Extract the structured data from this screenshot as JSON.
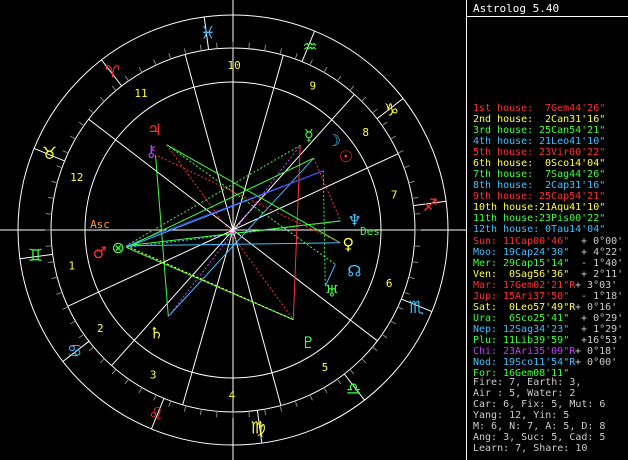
{
  "app": {
    "title": "Astrolog 5.40"
  },
  "colors": {
    "background": "#000000",
    "fire": "#ff2020",
    "earth": "#ffff00",
    "air": "#00ff40",
    "water": "#00c0ff",
    "ruler_orange": "#ff9a30",
    "purple": "#c040ff",
    "white": "#ffffff"
  },
  "wheel": {
    "houses": [
      "1",
      "2",
      "3",
      "4",
      "5",
      "6",
      "7",
      "8",
      "9",
      "10",
      "11",
      "12"
    ],
    "angles": [
      "Asc",
      "Des"
    ],
    "signs": [
      {
        "name": "aries-glyph",
        "glyph": "♈"
      },
      {
        "name": "taurus-glyph",
        "glyph": "♉"
      },
      {
        "name": "gemini-glyph",
        "glyph": "♊"
      },
      {
        "name": "cancer-glyph",
        "glyph": "♋"
      },
      {
        "name": "leo-glyph",
        "glyph": "♌"
      },
      {
        "name": "virgo-glyph",
        "glyph": "♍"
      },
      {
        "name": "libra-glyph",
        "glyph": "♎"
      },
      {
        "name": "scorpio-glyph",
        "glyph": "♏"
      },
      {
        "name": "sagittarius-glyph",
        "glyph": "♐"
      },
      {
        "name": "capricorn-glyph",
        "glyph": "♑"
      },
      {
        "name": "aquarius-glyph",
        "glyph": "♒"
      },
      {
        "name": "pisces-glyph",
        "glyph": "♓"
      }
    ],
    "planet_glyphs": [
      {
        "name": "sun-glyph",
        "glyph": "☉"
      },
      {
        "name": "moon-glyph",
        "glyph": "☽"
      },
      {
        "name": "mercury-glyph",
        "glyph": "☿"
      },
      {
        "name": "venus-glyph",
        "glyph": "♀"
      },
      {
        "name": "mars-glyph",
        "glyph": "♂"
      },
      {
        "name": "jupiter-glyph",
        "glyph": "♃"
      },
      {
        "name": "saturn-glyph",
        "glyph": "♄"
      },
      {
        "name": "uranus-glyph",
        "glyph": "♅"
      },
      {
        "name": "neptune-glyph",
        "glyph": "♆"
      },
      {
        "name": "pluto-glyph",
        "glyph": "♇"
      },
      {
        "name": "chiron-glyph",
        "glyph": "⚷"
      },
      {
        "name": "node-glyph",
        "glyph": "☊"
      },
      {
        "name": "fortune-glyph",
        "glyph": "⊗"
      }
    ]
  },
  "houses_list": [
    {
      "label": "1st house:",
      "pos": " 7Gem44'26\"",
      "color": "#ff3030"
    },
    {
      "label": "2nd house:",
      "pos": " 2Can31'16\"",
      "color": "#ffff40"
    },
    {
      "label": "3rd house:",
      "pos": "25Can54'21\"",
      "color": "#40ff40"
    },
    {
      "label": "4th house:",
      "pos": "21Leo41'10\"",
      "color": "#40c0ff"
    },
    {
      "label": "5th house:",
      "pos": "23Vir00'22\"",
      "color": "#ff3030"
    },
    {
      "label": "6th house:",
      "pos": " 0Sco14'04\"",
      "color": "#ffff40"
    },
    {
      "label": "7th house:",
      "pos": " 7Sag44'26\"",
      "color": "#40ff40"
    },
    {
      "label": "8th house:",
      "pos": " 2Cap31'16\"",
      "color": "#40c0ff"
    },
    {
      "label": "9th house:",
      "pos": "25Cap54'21\"",
      "color": "#ff3030"
    },
    {
      "label": "10th house:",
      "pos": "21Aqu41'10\"",
      "color": "#ffff40"
    },
    {
      "label": "11th house:",
      "pos": "23Pis00'22\"",
      "color": "#40ff40"
    },
    {
      "label": "12th house:",
      "pos": " 0Tau14'04\"",
      "color": "#40c0ff"
    }
  ],
  "planets_list": [
    {
      "label": "Sun:",
      "pos": "11Cap00'46\"",
      "dec": "  + 0°00'",
      "color": "#ff3030"
    },
    {
      "label": "Moo:",
      "pos": "19Cap24'30\"",
      "dec": "  + 4°22'",
      "color": "#40c0ff"
    },
    {
      "label": "Mer:",
      "pos": "29Cap15'14\"",
      "dec": "  - 1°40'",
      "color": "#40ff40"
    },
    {
      "label": "Ven:",
      "pos": " 0Sag56'36\"",
      "dec": "  + 2°11'",
      "color": "#ffff40"
    },
    {
      "label": "Mar:",
      "pos": "17Gem02'21\"R",
      "dec": " + 3°03'",
      "color": "#ff3030"
    },
    {
      "label": "Jup:",
      "pos": "15Ari37'50\"",
      "dec": "  - 1°18'",
      "color": "#ff3030"
    },
    {
      "label": "Sat:",
      "pos": " 0Leo57'49\"R",
      "dec": " + 0°16'",
      "color": "#ffff40"
    },
    {
      "label": "Ura:",
      "pos": " 6Sco25'41\"",
      "dec": "  + 0°29'",
      "color": "#40ff40"
    },
    {
      "label": "Nep:",
      "pos": "12Sag34'23\"",
      "dec": "  + 1°29'",
      "color": "#40c0ff"
    },
    {
      "label": "Plu:",
      "pos": "11Lib39'59\"",
      "dec": "  +16°53'",
      "color": "#40ff40"
    },
    {
      "label": "Chi:",
      "pos": "23Ari35'09\"R",
      "dec": " + 0°18'",
      "color": "#c040ff"
    },
    {
      "label": "Nod:",
      "pos": "19Sco11'54\"R",
      "dec": " + 0°00'",
      "color": "#40c0ff"
    },
    {
      "label": "For:",
      "pos": "16Gem08'11\"",
      "dec": "",
      "color": "#40ff40"
    }
  ],
  "elements": {
    "line1": "Fire: 7, Earth: 3,",
    "line2": "Air : 5, Water: 2",
    "line3": "Car: 6, Fix: 5, Mut: 6",
    "line4": "Yang: 12, Yin: 5",
    "line5": "M: 6, N: 7, A: 5, D: 8",
    "line6": "Ang: 3, Suc: 5, Cad: 5",
    "line7": "Learn: 7, Share: 10"
  }
}
